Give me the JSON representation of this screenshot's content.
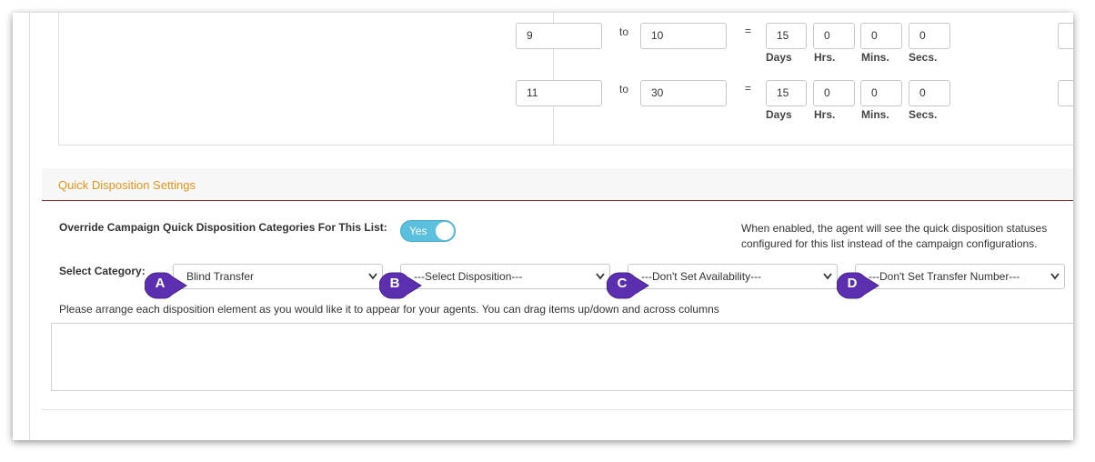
{
  "ranges": [
    {
      "from": "9",
      "to_label": "to",
      "to": "10",
      "eq": "=",
      "days": "15",
      "hrs": "0",
      "mins": "0",
      "secs": "0"
    },
    {
      "from": "11",
      "to_label": "to",
      "to": "30",
      "eq": "=",
      "days": "15",
      "hrs": "0",
      "mins": "0",
      "secs": "0"
    }
  ],
  "units": {
    "days": "Days",
    "hrs": "Hrs.",
    "mins": "Mins.",
    "secs": "Secs."
  },
  "quick_disposition": {
    "title": "Quick Disposition Settings",
    "override_label": "Override Campaign Quick Disposition Categories For This List:",
    "toggle": {
      "label": "Yes",
      "on": true
    },
    "help_text": "When enabled, the agent will see the quick disposition statuses configured for this list instead of the campaign configurations.",
    "category_label": "Select Category:",
    "selects": [
      {
        "value": "Blind Transfer",
        "badge": "A"
      },
      {
        "value": "---Select Disposition---",
        "badge": "B"
      },
      {
        "value": "---Don't Set Availability---",
        "badge": "C"
      },
      {
        "value": "---Don't Set Transfer Number---",
        "badge": "D"
      }
    ],
    "instructions": "Please arrange each disposition element as you would like it to appear for your agents. You can drag items up/down and across columns"
  },
  "colors": {
    "section_title": "#e8941a",
    "toggle_on": "#5bc0de",
    "badge": "#5b2fb0",
    "section_rule": "#8a2b2b"
  },
  "icons": {
    "select_arrow": "chevron-down-icon"
  }
}
